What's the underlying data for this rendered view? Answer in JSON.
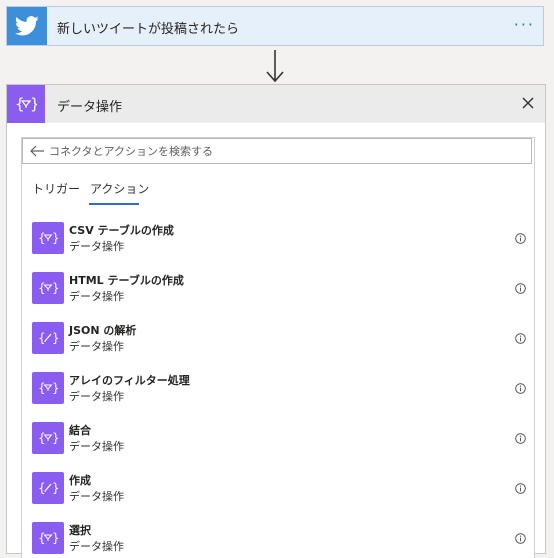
{
  "trigger": {
    "icon": "twitter-bird-icon",
    "title": "新しいツイートが投稿されたら",
    "more_label": "···",
    "color": "#3d8fd9"
  },
  "flow_arrow_icon": "arrow-down-icon",
  "action": {
    "icon": "data-operation-icon",
    "title": "データ操作",
    "close_icon": "close-icon",
    "color": "#8a5cf0",
    "search": {
      "placeholder": "コネクタとアクションを検索する",
      "value": ""
    },
    "tabs": [
      {
        "label": "トリガー",
        "active": false
      },
      {
        "label": "アクション",
        "active": true
      }
    ],
    "items": [
      {
        "title": "CSV テーブルの作成",
        "subtitle": "データ操作",
        "icon": "curly-braces-filter-icon"
      },
      {
        "title": "HTML テーブルの作成",
        "subtitle": "データ操作",
        "icon": "curly-braces-filter-icon"
      },
      {
        "title": "JSON の解析",
        "subtitle": "データ操作",
        "icon": "curly-braces-edit-icon"
      },
      {
        "title": "アレイのフィルター処理",
        "subtitle": "データ操作",
        "icon": "curly-braces-filter-icon"
      },
      {
        "title": "結合",
        "subtitle": "データ操作",
        "icon": "curly-braces-filter-icon"
      },
      {
        "title": "作成",
        "subtitle": "データ操作",
        "icon": "curly-braces-edit-icon"
      },
      {
        "title": "選択",
        "subtitle": "データ操作",
        "icon": "curly-braces-filter-icon"
      }
    ]
  }
}
